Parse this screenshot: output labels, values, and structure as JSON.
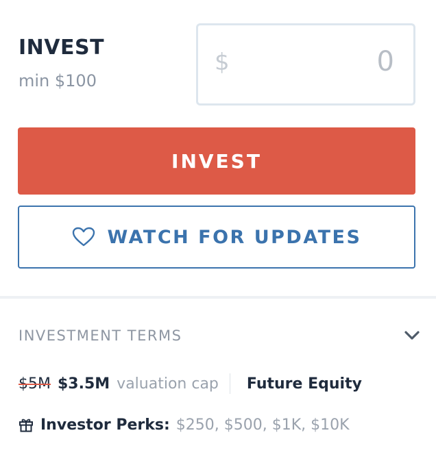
{
  "invest": {
    "title": "INVEST",
    "minimum": "min $100"
  },
  "amount_input": {
    "currency": "$",
    "value": "0"
  },
  "buttons": {
    "invest_label": "INVEST",
    "watch_label": "WATCH FOR UPDATES"
  },
  "terms": {
    "header": "INVESTMENT TERMS",
    "old_valuation": "$5M",
    "new_valuation": "$3.5M",
    "valuation_desc": "valuation cap",
    "security_type": "Future Equity"
  },
  "perks": {
    "label": "Investor Perks:",
    "values": "$250, $500, $1K, $10K"
  },
  "colors": {
    "accent_red": "#dd5a47",
    "accent_blue": "#3b73ad",
    "text_dark": "#1f2b3d",
    "text_muted": "#8e96a2"
  },
  "icons": {
    "watch": "heart-icon",
    "terms_toggle": "chevron-down-icon",
    "perks": "gift-icon"
  }
}
